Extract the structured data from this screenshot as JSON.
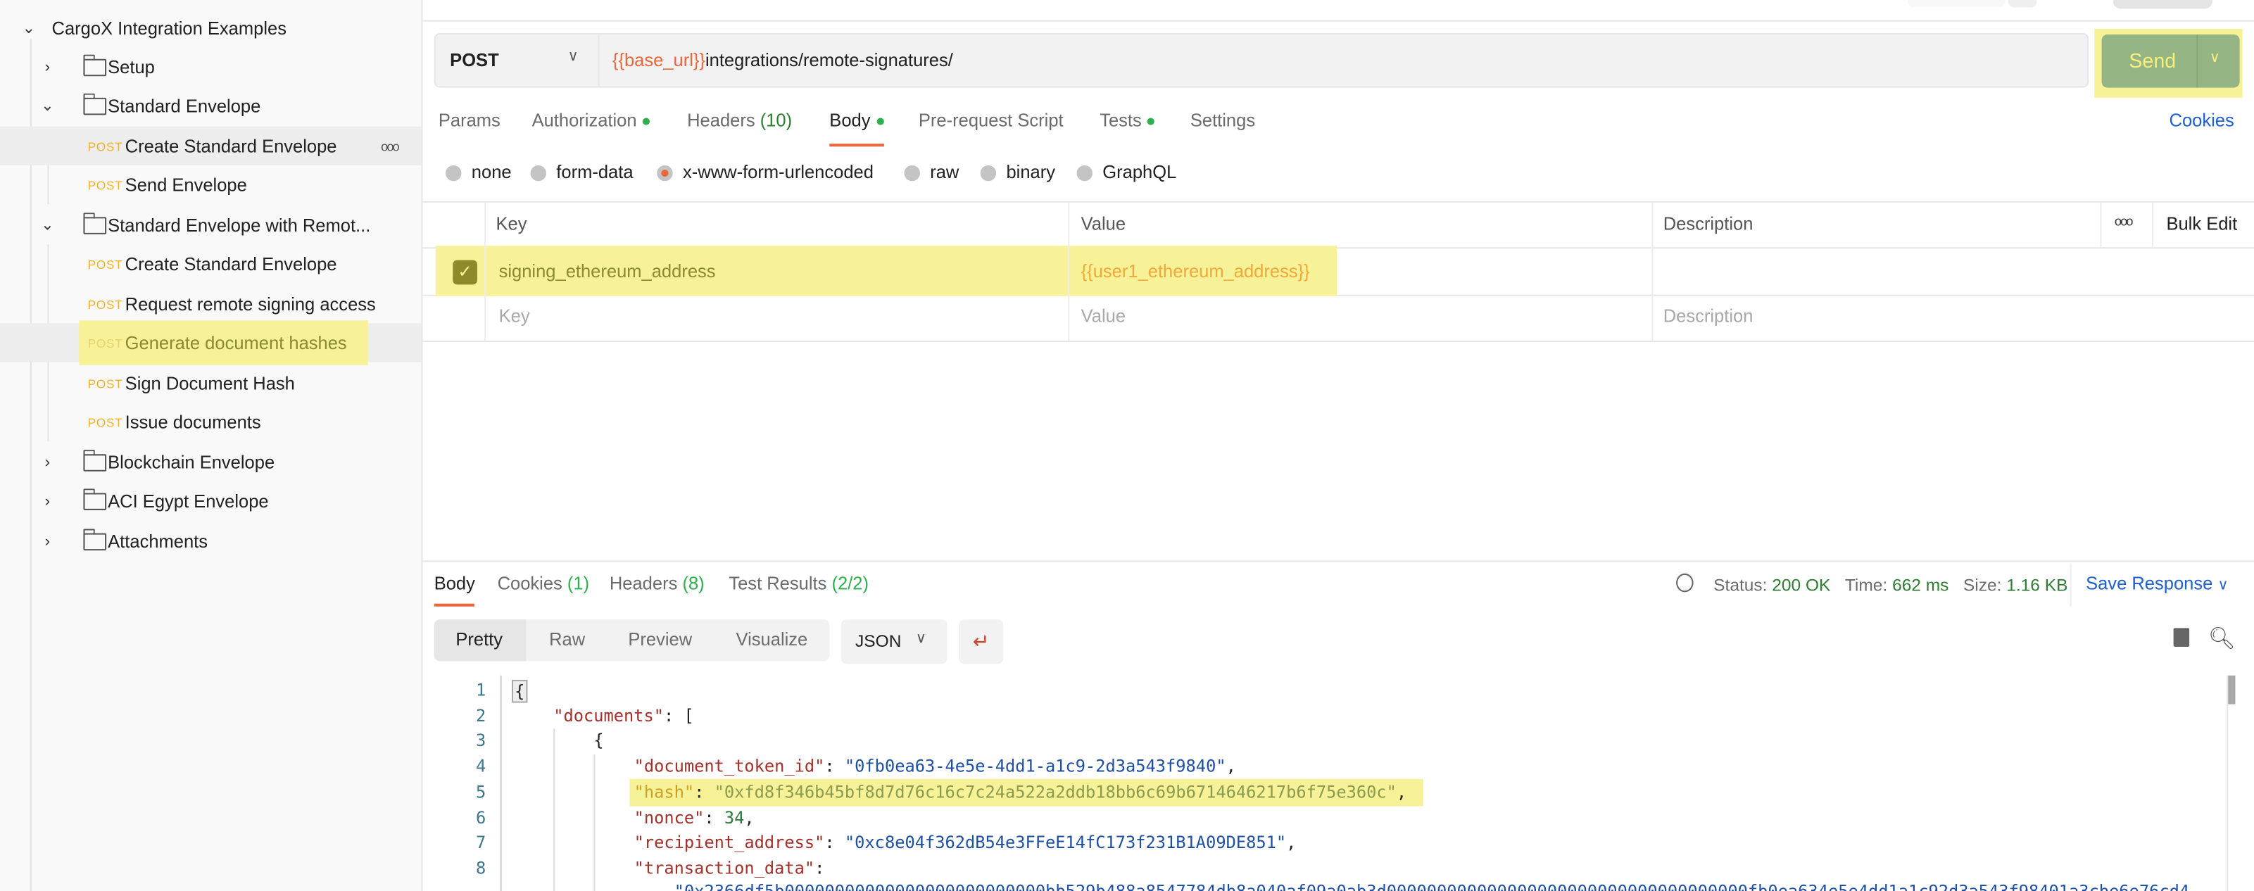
{
  "sidebar": {
    "collection": "CargoX Integration Examples",
    "method_label": "POST",
    "items": [
      {
        "type": "folder",
        "label": "Setup",
        "expanded": false
      },
      {
        "type": "folder",
        "label": "Standard Envelope",
        "expanded": true
      },
      {
        "type": "request",
        "label": "Create Standard Envelope"
      },
      {
        "type": "request",
        "label": "Send Envelope"
      },
      {
        "type": "folder",
        "label": "Standard Envelope with Remot...",
        "expanded": true
      },
      {
        "type": "request",
        "label": "Create Standard Envelope"
      },
      {
        "type": "request",
        "label": "Request remote signing access"
      },
      {
        "type": "request",
        "label": "Generate document hashes"
      },
      {
        "type": "request",
        "label": "Sign Document Hash"
      },
      {
        "type": "request",
        "label": "Issue documents"
      },
      {
        "type": "folder",
        "label": "Blockchain Envelope",
        "expanded": false
      },
      {
        "type": "folder",
        "label": "ACI Egypt Envelope",
        "expanded": false
      },
      {
        "type": "folder",
        "label": "Attachments",
        "expanded": false
      }
    ]
  },
  "request": {
    "method": "POST",
    "url_variable": "{{base_url}}",
    "url_path": "integrations/remote-signatures/",
    "send_label": "Send",
    "tabs": [
      {
        "label": "Params"
      },
      {
        "label": "Authorization",
        "dot": true
      },
      {
        "label": "Headers",
        "count": "(10)"
      },
      {
        "label": "Body",
        "dot": true,
        "active": true
      },
      {
        "label": "Pre-request Script"
      },
      {
        "label": "Tests",
        "dot": true
      },
      {
        "label": "Settings"
      }
    ],
    "cookies_link": "Cookies",
    "body_types": [
      "none",
      "form-data",
      "x-www-form-urlencoded",
      "raw",
      "binary",
      "GraphQL"
    ],
    "selected_body_type": "x-www-form-urlencoded",
    "table": {
      "headers": {
        "key": "Key",
        "value": "Value",
        "description": "Description",
        "bulk_edit": "Bulk Edit"
      },
      "rows": [
        {
          "checked": true,
          "key": "signing_ethereum_address",
          "value": "{{user1_ethereum_address}}",
          "description": ""
        }
      ],
      "placeholders": {
        "key": "Key",
        "value": "Value",
        "description": "Description"
      }
    }
  },
  "response": {
    "tabs": [
      {
        "label": "Body",
        "active": true
      },
      {
        "label": "Cookies",
        "count": "(1)"
      },
      {
        "label": "Headers",
        "count": "(8)"
      },
      {
        "label": "Test Results",
        "count": "(2/2)"
      }
    ],
    "status_label": "Status:",
    "status": "200 OK",
    "time_label": "Time:",
    "time": "662 ms",
    "size_label": "Size:",
    "size": "1.16 KB",
    "save_response": "Save Response",
    "view_modes": [
      "Pretty",
      "Raw",
      "Preview",
      "Visualize"
    ],
    "format": "JSON",
    "code": {
      "line_numbers": [
        "1",
        "2",
        "3",
        "4",
        "5",
        "6",
        "7",
        "8"
      ],
      "documents_key": "\"documents\"",
      "document_token_id_key": "\"document_token_id\"",
      "document_token_id": "\"0fb0ea63-4e5e-4dd1-a1c9-2d3a543f9840\"",
      "hash_key": "\"hash\"",
      "hash": "\"0xfd8f346b45bf8d7d76c16c7c24a522a2ddb18bb6c69b6714646217b6f75e360c\"",
      "nonce_key": "\"nonce\"",
      "nonce": "34",
      "recipient_address_key": "\"recipient_address\"",
      "recipient_address": "\"0xc8e04f362dB54e3FFeE14fC173f231B1A09DE851\"",
      "transaction_data_key": "\"transaction_data\"",
      "transaction_data_partial": "\"0x2366df5b00000000000000000000000000bb529b488a8547784db8a040af09a0ab3d000000000000000000000000000000000000fb0ea634e5e4dd1a1c92d3a543f98401a3cbe6e76cd4"
    }
  }
}
